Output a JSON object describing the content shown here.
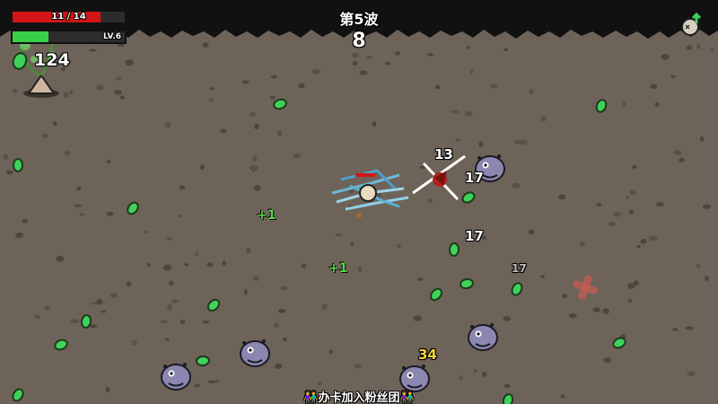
{
  "hud": {
    "hp_text": "11 / 14",
    "hp_current": 11,
    "hp_max": 14,
    "level_text": "LV.6",
    "xp_fraction": 0.32,
    "materials": "124",
    "wave_title": "第5波",
    "wave_timer": "8"
  },
  "floating_numbers": {
    "dmg_1": "13",
    "dmg_2": "17",
    "dmg_3": "17",
    "dmg_4": "17",
    "dmg_5": "34",
    "heal_1": "+1",
    "heal_2": "+1"
  },
  "banner": {
    "text": "👫办卡加入粉丝团👫"
  },
  "colors": {
    "ground": "#6e6358",
    "hp": "#d31515",
    "xp": "#38d046",
    "material": "#3fd25a",
    "enemy": "#8b87b0",
    "crit": "#f5d23a"
  }
}
